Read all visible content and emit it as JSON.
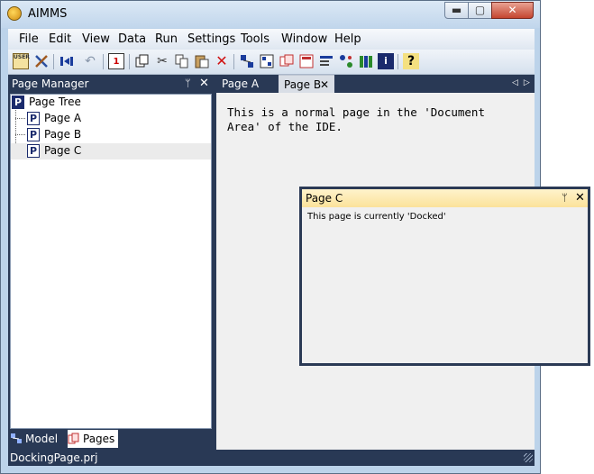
{
  "window": {
    "title": "AIMMS",
    "min_label": "▬",
    "max_label": "▢",
    "close_label": "✕"
  },
  "menu": [
    "File",
    "Edit",
    "View",
    "Data",
    "Run",
    "Settings",
    "Tools",
    "Window",
    "Help"
  ],
  "toolbar": {
    "icons": [
      "user-menu-icon",
      "tools-icon",
      "step-icon",
      "undo-icon",
      "calendar-icon",
      "copy-pages-icon",
      "cut-icon",
      "copy-icon",
      "paste-icon",
      "delete-icon",
      "model-explorer-icon",
      "identifier-selector-icon",
      "page-manager-icon",
      "template-manager-icon",
      "menu-builder-icon",
      "data-manager-icon",
      "library-icon",
      "info-icon",
      "help-icon"
    ],
    "user_label": "USER",
    "calendar_label": "1",
    "help_label": "?"
  },
  "page_manager": {
    "title": "Page Manager",
    "pin": "ᛘ",
    "close": "✕",
    "tree": {
      "root": "Page Tree",
      "root_icon_letter": "P",
      "items": [
        "Page A",
        "Page B",
        "Page C"
      ],
      "item_icon_letter": "P",
      "selected_index": 2
    },
    "tabs": [
      "Model",
      "Pages"
    ],
    "active_tab": "Pages"
  },
  "doc": {
    "tabs": [
      "Page A",
      "Page B"
    ],
    "active_tab": "Page B",
    "close": "✕",
    "scroll_left": "◁",
    "scroll_right": "▷",
    "text": "This is a normal page in the 'Document Area' of the IDE."
  },
  "float_window": {
    "title": "Page C",
    "pin": "ᛘ",
    "close": "✕",
    "text": "This page is currently 'Docked'"
  },
  "status": {
    "text": "DockingPage.prj"
  },
  "colors": {
    "frame_dark": "#293955",
    "float_header": "#fbe29a",
    "window_bg": "#bcd3ea"
  }
}
